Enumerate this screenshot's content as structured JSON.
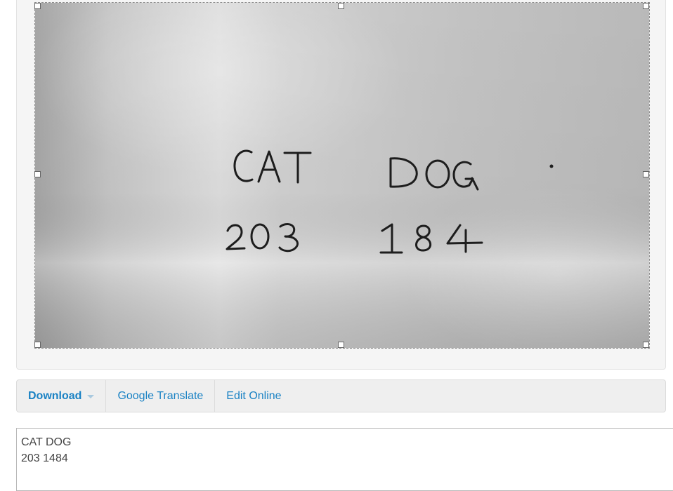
{
  "image": {
    "handwritten_text": [
      "CAT",
      "DOG",
      "203",
      "184"
    ]
  },
  "toolbar": {
    "download_label": "Download",
    "translate_label": "Google Translate",
    "edit_label": "Edit Online"
  },
  "result": {
    "text": "CAT DOG\n203 1484"
  },
  "colors": {
    "link": "#1a82c4",
    "panel_bg": "#f5f5f5",
    "toolbar_bg": "#efefef"
  }
}
